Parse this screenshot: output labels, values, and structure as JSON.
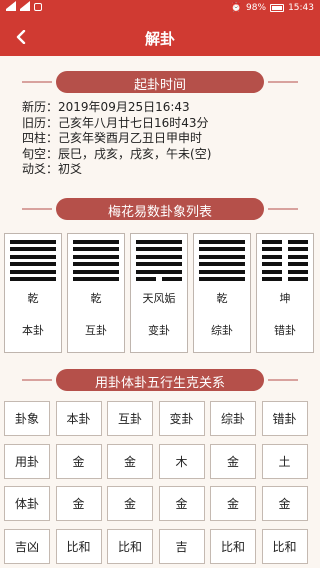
{
  "status_bar": {
    "battery_percent": "98%",
    "time": "15:43"
  },
  "header": {
    "back_icon": "chevron-left-icon",
    "title": "解卦"
  },
  "section_qigua": {
    "title": "起卦时间",
    "rows": [
      {
        "label": "新历：",
        "value": "2019年09月25日16:43"
      },
      {
        "label": "旧历：",
        "value": "己亥年八月廿七日16时43分"
      },
      {
        "label": "四柱：",
        "value": "己亥年癸酉月乙丑日甲申时"
      },
      {
        "label": "旬空：",
        "value": "辰巳，戌亥，戌亥，午未(空)"
      },
      {
        "label": "动爻：",
        "value": "初爻"
      }
    ]
  },
  "section_hexagrams": {
    "title": "梅花易数卦象列表",
    "cards": [
      {
        "name": "乾",
        "type": "本卦",
        "lines": [
          "yang",
          "yang",
          "yang",
          "yang",
          "yang",
          "yang"
        ]
      },
      {
        "name": "乾",
        "type": "互卦",
        "lines": [
          "yang",
          "yang",
          "yang",
          "yang",
          "yang",
          "yang"
        ]
      },
      {
        "name": "天风姤",
        "type": "变卦",
        "lines": [
          "yang",
          "yang",
          "yang",
          "yang",
          "yang",
          "yin"
        ]
      },
      {
        "name": "乾",
        "type": "综卦",
        "lines": [
          "yang",
          "yang",
          "yang",
          "yang",
          "yang",
          "yang"
        ]
      },
      {
        "name": "坤",
        "type": "错卦",
        "lines": [
          "yin",
          "yin",
          "yin",
          "yin",
          "yin",
          "yin"
        ]
      }
    ]
  },
  "section_wuxing": {
    "title": "用卦体卦五行生克关系",
    "rows": [
      [
        "卦象",
        "本卦",
        "互卦",
        "变卦",
        "综卦",
        "错卦"
      ],
      [
        "用卦",
        "金",
        "金",
        "木",
        "金",
        "土"
      ],
      [
        "体卦",
        "金",
        "金",
        "金",
        "金",
        "金"
      ],
      [
        "吉凶",
        "比和",
        "比和",
        "吉",
        "比和",
        "比和"
      ]
    ]
  }
}
